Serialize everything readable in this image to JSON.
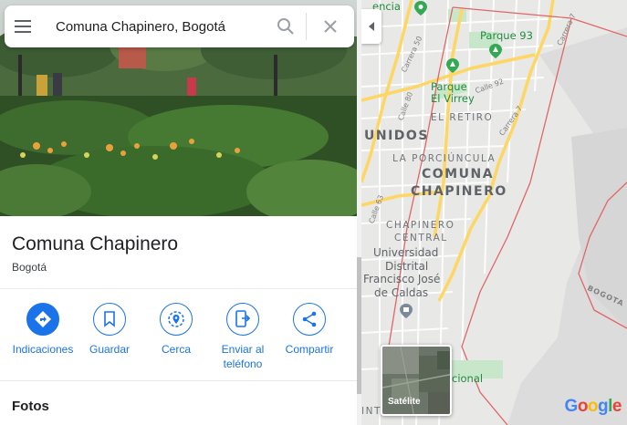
{
  "search": {
    "query": "Comuna Chapinero, Bogotá"
  },
  "place": {
    "title": "Comuna Chapinero",
    "subtitle": "Bogotá"
  },
  "actions": [
    {
      "label": "Indicaciones",
      "icon": "directions-icon"
    },
    {
      "label": "Guardar",
      "icon": "bookmark-icon"
    },
    {
      "label": "Cerca",
      "icon": "nearby-icon"
    },
    {
      "label": "Enviar al teléfono",
      "icon": "send-to-phone-icon"
    },
    {
      "label": "Compartir",
      "icon": "share-icon"
    }
  ],
  "sections": {
    "photos_title": "Fotos"
  },
  "map": {
    "labels": {
      "comuna": "COMUNA",
      "chapinero": "CHAPINERO",
      "porciuncula": "LA PORCIÚNCULA",
      "el_retiro": "EL RETIRO",
      "unidos": "UNIDOS",
      "chapinero_central_1": "CHAPINERO",
      "chapinero_central_2": "CENTRAL",
      "parque93": "Parque 93",
      "parque_virrey_1": "Parque",
      "parque_virrey_2": "El Virrey",
      "universidad_1": "Universidad",
      "universidad_2": "Distrital",
      "universidad_3": "Francisco José",
      "universidad_4": "de Caldas",
      "encia": "encia",
      "cional": "cional",
      "bogota_road": "BOGOTA",
      "carrera50": "Carrera 50",
      "carrera7a": "Carrera 7",
      "carrera7b": "Carrera 7",
      "calle92": "Calle 92",
      "calle80": "Calle 80",
      "calle63": "Calle 63",
      "int": "INT"
    },
    "satellite_label": "Satélite",
    "google_logo": [
      "G",
      "o",
      "o",
      "g",
      "l",
      "e"
    ],
    "colors": {
      "district_border": "#e06666",
      "major_road": "#fdd663",
      "park": "#c8e6c9",
      "land": "#e8e8e6",
      "hills": "#d9d9d9"
    }
  },
  "colors": {
    "accent": "#1a73e8",
    "text": "#202124",
    "google_blue": "#4285f4",
    "google_red": "#ea4335",
    "google_yellow": "#fbbc04",
    "google_green": "#34a853"
  }
}
